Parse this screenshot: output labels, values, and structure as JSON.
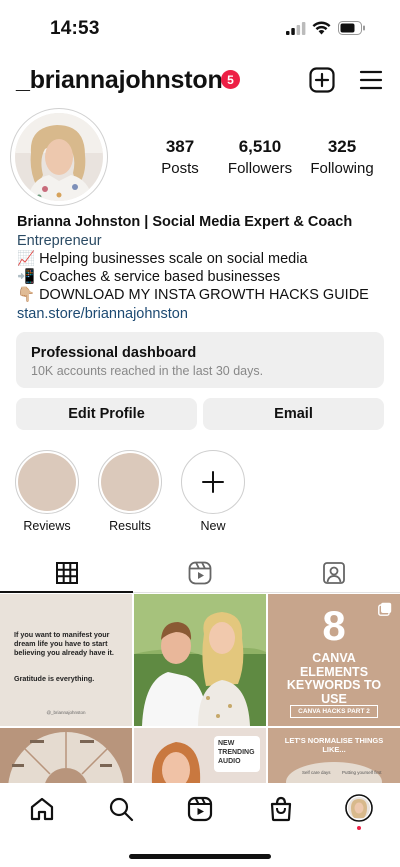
{
  "status_bar": {
    "time": "14:53"
  },
  "header": {
    "username": "_briannajohnston",
    "notification_count": "5"
  },
  "stats": [
    {
      "value": "387",
      "label": "Posts"
    },
    {
      "value": "6,510",
      "label": "Followers"
    },
    {
      "value": "325",
      "label": "Following"
    }
  ],
  "bio": {
    "name": "Brianna Johnston | Social Media Expert & Coach",
    "category": "Entrepreneur",
    "lines": [
      "📈 Helping businesses scale on social media",
      "📲 Coaches & service based businesses",
      "👇🏼 DOWNLOAD MY INSTA GROWTH HACKS GUIDE"
    ],
    "link": "stan.store/briannajohnston"
  },
  "dashboard": {
    "title": "Professional dashboard",
    "subtitle": "10K accounts reached in the last 30 days."
  },
  "buttons": {
    "edit_profile": "Edit Profile",
    "email": "Email"
  },
  "highlights": [
    {
      "label": "Reviews"
    },
    {
      "label": "Results"
    },
    {
      "label": "New"
    }
  ],
  "posts": {
    "post1": {
      "text": "If you want to manifest your dream life you have to start believing you",
      "bold": "already have it.",
      "footer": "Gratitude is everything.",
      "handle": "@_briannajohnston"
    },
    "post3": {
      "number": "8",
      "title": "CANVA ELEMENTS KEYWORDS TO USE",
      "tag": "CANVA HACKS PART 2"
    },
    "post5": {
      "badge_line1": "NEW",
      "badge_line2": "TRENDING",
      "badge_line3": "AUDIO"
    },
    "post6": {
      "title": "LET'S NORMALISE THINGS LIKE...",
      "item1": "Self care days",
      "item2": "Putting yourself first"
    }
  },
  "colors": {
    "accent_badge": "#ed1f45",
    "tan": "#c8a891",
    "dark_tan": "#b8957c",
    "cream": "#e8ded4"
  }
}
